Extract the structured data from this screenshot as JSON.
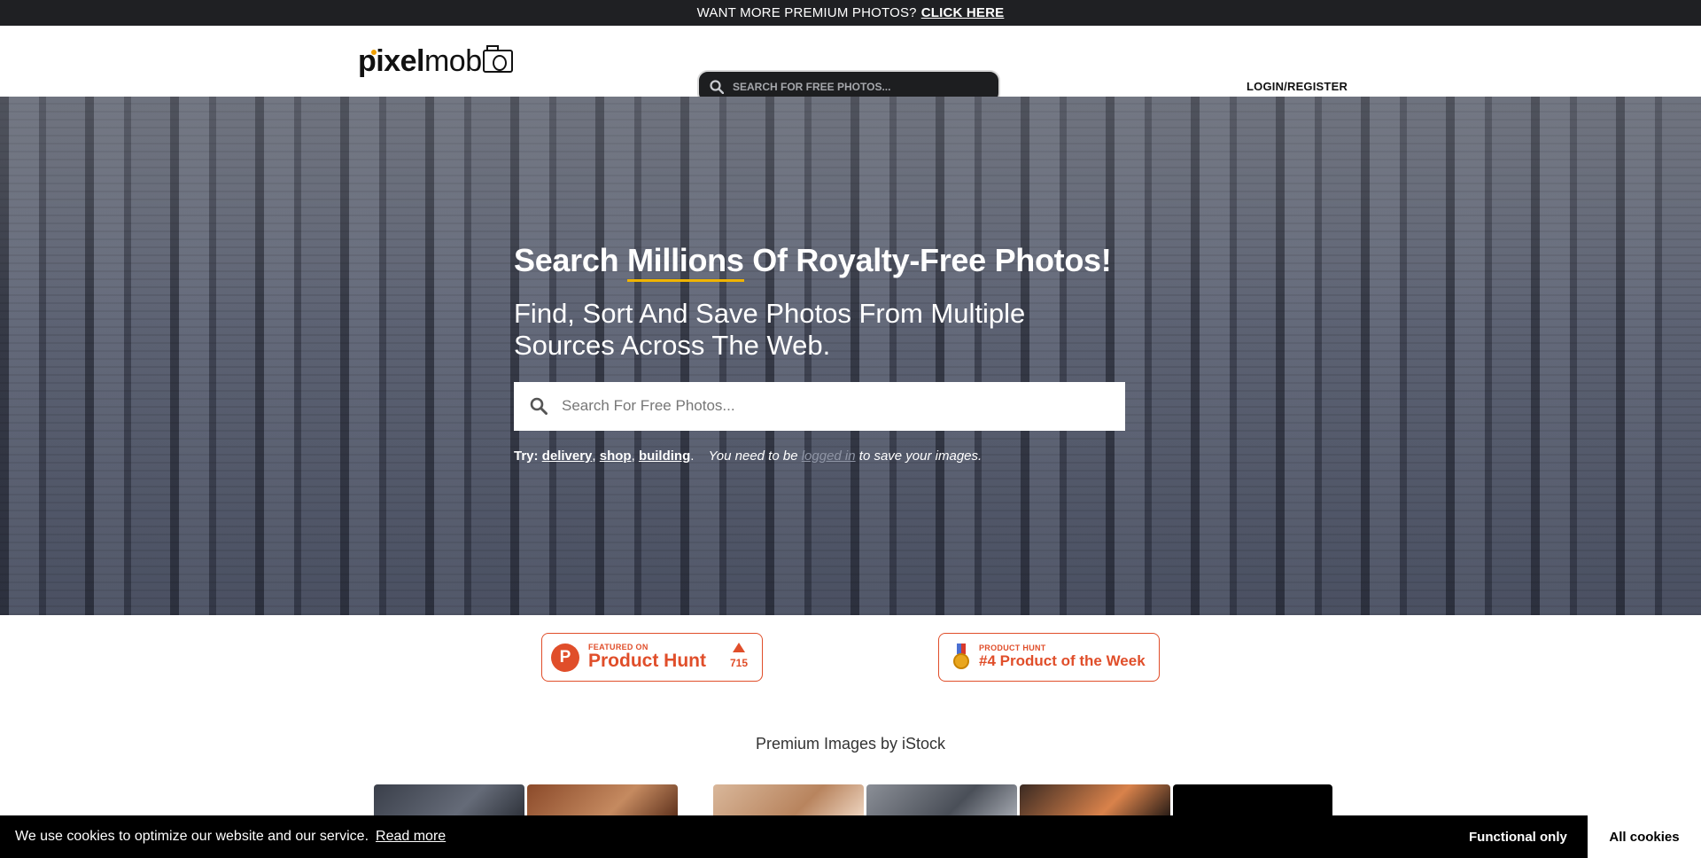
{
  "promo": {
    "text": "WANT MORE PREMIUM PHOTOS?",
    "cta": "CLICK HERE"
  },
  "header": {
    "logo_bold": "pixel",
    "logo_light": "mob",
    "search_placeholder": "SEARCH FOR FREE PHOTOS...",
    "login": "LOGIN/REGISTER"
  },
  "hero": {
    "title_pre": "Search",
    "title_accent": "Millions",
    "title_post": "Of Royalty-Free Photos!",
    "subtitle": "Find, Sort And Save Photos From Multiple Sources Across The Web.",
    "search_placeholder": "Search For Free Photos...",
    "try_label": "Try:",
    "try_items": [
      "delivery",
      "shop",
      "building"
    ],
    "note_pre": "You need to be",
    "note_link": "logged in",
    "note_post": "to save your images."
  },
  "badges": {
    "ph_featured_small": "FEATURED ON",
    "ph_featured_big": "Product Hunt",
    "ph_featured_votes": "715",
    "ph_week_small": "PRODUCT HUNT",
    "ph_week_big": "#4 Product of the Week"
  },
  "premium": {
    "title": "Premium Images by iStock"
  },
  "cookie": {
    "message": "We use cookies to optimize our website and our service.",
    "read_more": "Read more",
    "functional": "Functional only",
    "all": "All cookies"
  },
  "colors": {
    "accent": "#f0b400",
    "product_hunt": "#e04e2a",
    "dark": "#1f2023"
  }
}
